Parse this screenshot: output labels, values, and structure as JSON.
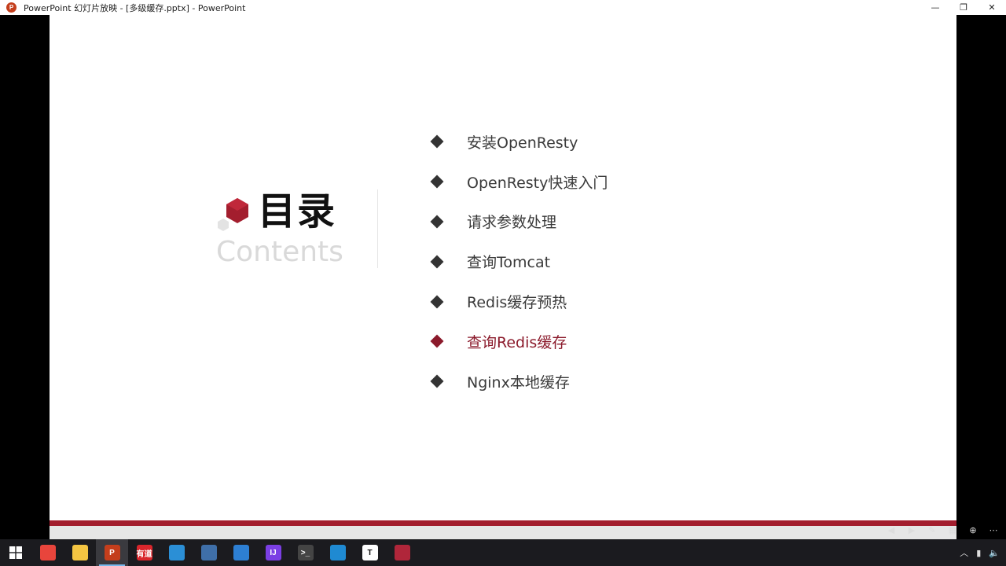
{
  "window": {
    "title": "PowerPoint 幻灯片放映 - [多级缓存.pptx] - PowerPoint",
    "app_icon_label": "P",
    "controls": {
      "minimize": "—",
      "restore": "❐",
      "close": "✕"
    }
  },
  "slide": {
    "title": "目录",
    "subtitle": "Contents",
    "accent_color": "#a31e2e",
    "items": [
      {
        "label": "安装OpenResty",
        "active": false
      },
      {
        "label": "OpenResty快速入门",
        "active": false
      },
      {
        "label": "请求参数处理",
        "active": false
      },
      {
        "label": "查询Tomcat",
        "active": false
      },
      {
        "label": "Redis缓存预热",
        "active": false
      },
      {
        "label": "查询Redis缓存",
        "active": true
      },
      {
        "label": "Nginx本地缓存",
        "active": false
      }
    ]
  },
  "taskbar": {
    "apps": [
      {
        "name": "chrome-icon",
        "label": "",
        "color": "#e8453c"
      },
      {
        "name": "file-explorer-icon",
        "label": "",
        "color": "#f4c542"
      },
      {
        "name": "powerpoint-icon",
        "label": "P",
        "color": "#c43e1c",
        "active": true
      },
      {
        "name": "app-red-icon",
        "label": "有道",
        "color": "#d9262c"
      },
      {
        "name": "app-window-icon",
        "label": "",
        "color": "#2b8fd6"
      },
      {
        "name": "app-monitor-icon",
        "label": "",
        "color": "#3f6fa8"
      },
      {
        "name": "app-swirl-icon",
        "label": "",
        "color": "#2d7fd3"
      },
      {
        "name": "intellij-icon",
        "label": "IJ",
        "color": "#7b3fe4"
      },
      {
        "name": "terminal-icon",
        "label": ">_",
        "color": "#444444"
      },
      {
        "name": "vscode-icon",
        "label": "",
        "color": "#1f8ad2"
      },
      {
        "name": "typora-icon",
        "label": "T",
        "color": "#ffffff"
      },
      {
        "name": "app-round-icon",
        "label": "",
        "color": "#b0263a"
      }
    ]
  }
}
